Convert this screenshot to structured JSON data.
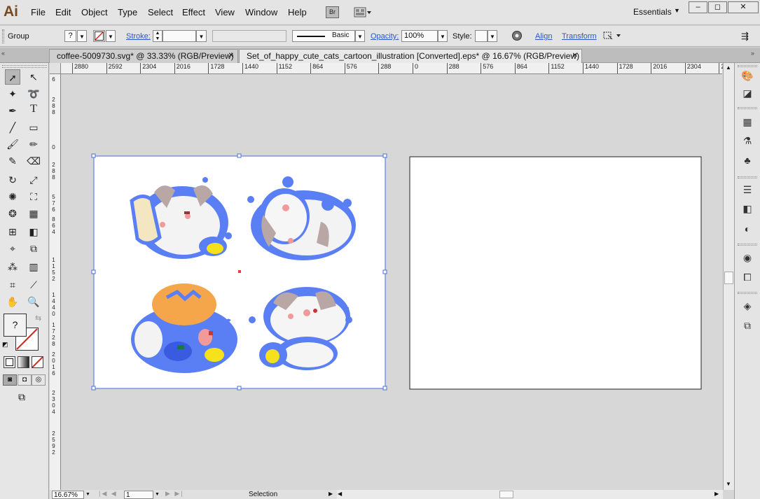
{
  "app": {
    "logo": "Ai"
  },
  "menu": [
    "File",
    "Edit",
    "Object",
    "Type",
    "Select",
    "Effect",
    "View",
    "Window",
    "Help"
  ],
  "bridge_label": "Br",
  "workspace": {
    "label": "Essentials",
    "arrow": "▼"
  },
  "window_controls": {
    "minimize": "–",
    "restore": "◻",
    "close": "✕"
  },
  "control_bar": {
    "selection": "Group",
    "fill_value": "?",
    "stroke_label": "Stroke:",
    "stroke_weight": "",
    "brush": "Basic",
    "opacity_label": "Opacity:",
    "opacity_value": "100%",
    "style_label": "Style:",
    "align_label": "Align",
    "transform_label": "Transform"
  },
  "tabs": [
    {
      "title": "coffee-5009730.svg* @ 33.33% (RGB/Preview)",
      "close": "✕"
    },
    {
      "title": "Set_of_happy_cute_cats_cartoon_illustration [Converted].eps* @ 16.67% (RGB/Preview)",
      "close": "✕"
    }
  ],
  "ruler": {
    "h_ticks": [
      "2880",
      "2592",
      "2304",
      "2016",
      "1728",
      "1440",
      "1152",
      "864",
      "576",
      "288",
      "0",
      "288",
      "576",
      "864",
      "1152",
      "1440",
      "1728",
      "2016",
      "2304",
      "25"
    ],
    "v_labels": [
      [
        "6"
      ],
      [
        "2",
        "8",
        "8"
      ],
      [
        "0"
      ],
      [
        "2",
        "8",
        "8"
      ],
      [
        "5",
        "7",
        "6"
      ],
      [
        "8",
        "6",
        "4"
      ],
      [
        "1",
        "1",
        "5",
        "2"
      ],
      [
        "1",
        "4",
        "4",
        "0"
      ],
      [
        "1",
        "7",
        "2",
        "8"
      ],
      [
        "2",
        "0",
        "1",
        "6"
      ],
      [
        "2",
        "3",
        "0",
        "4"
      ],
      [
        "2",
        "5",
        "9",
        "2"
      ]
    ]
  },
  "fill_stroke": {
    "fill": "?"
  },
  "status": {
    "zoom": "16.67%",
    "page": "1",
    "tool": "Selection"
  },
  "colors": {
    "accent_link": "#2a56c6",
    "selection": "#4a6fd8",
    "artboard_red": "#cc3333"
  }
}
